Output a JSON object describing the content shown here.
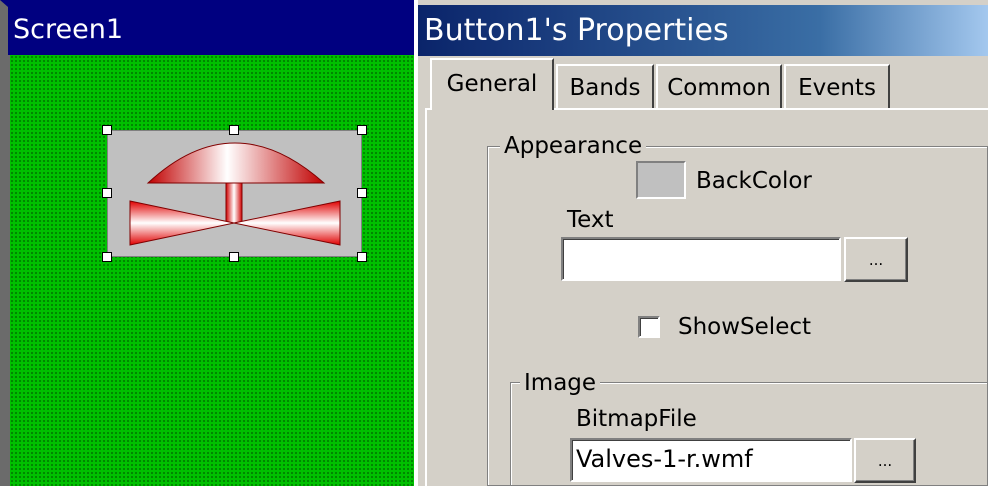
{
  "screen_window": {
    "title": "Screen1",
    "canvas_color": "#00c000",
    "selected_control": {
      "icon": "valve-icon",
      "colors": {
        "body": "#c0c0c0",
        "valve_red": "#e00000"
      }
    }
  },
  "properties_window": {
    "title": "Button1's Properties",
    "tabs": [
      {
        "label": "General",
        "selected": true
      },
      {
        "label": "Bands",
        "selected": false
      },
      {
        "label": "Common",
        "selected": false
      },
      {
        "label": "Events",
        "selected": false
      }
    ],
    "appearance": {
      "caption": "Appearance",
      "backcolor_label": "BackColor",
      "backcolor_value": "#c0c0c0",
      "text_label": "Text",
      "text_value": "",
      "browse_label": "...",
      "showselect_label": "ShowSelect",
      "showselect_checked": false
    },
    "image": {
      "caption": "Image",
      "bitmapfile_label": "BitmapFile",
      "bitmapfile_value": "Valves-1-r.wmf",
      "browse_label": "..."
    }
  }
}
